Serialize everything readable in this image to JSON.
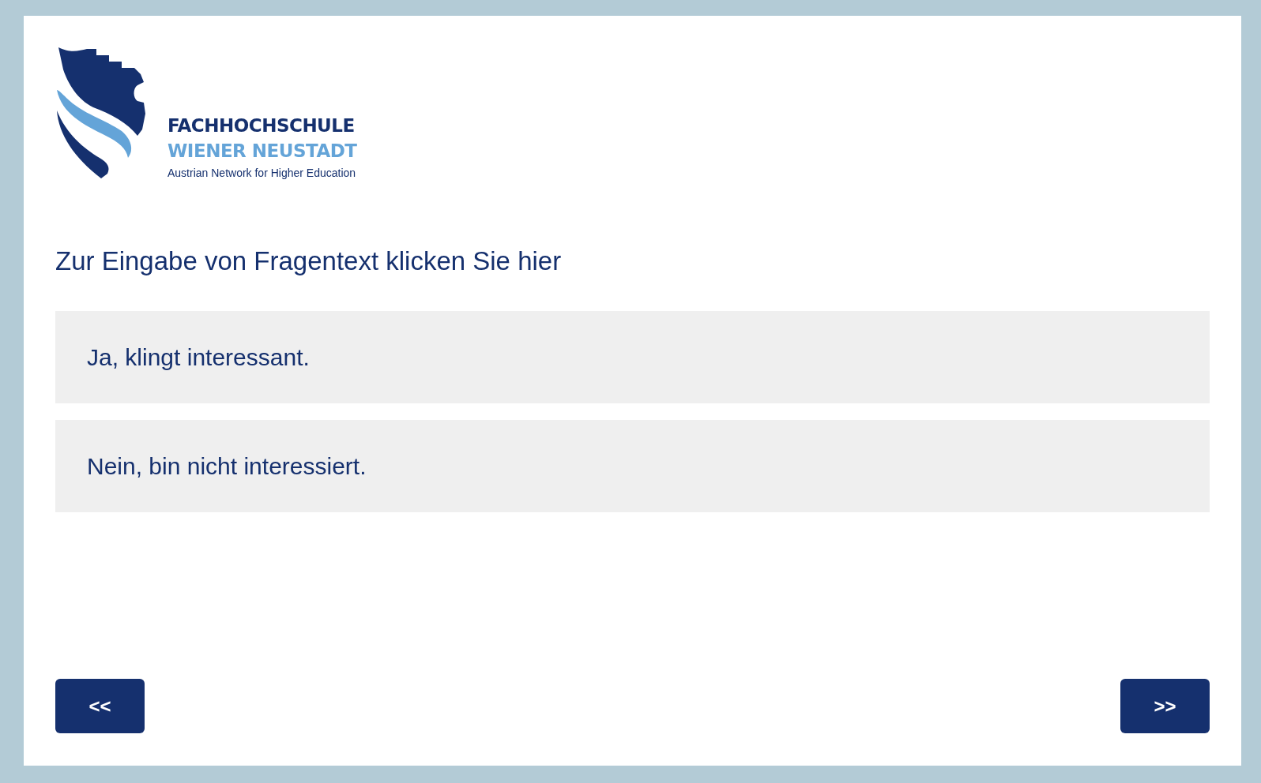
{
  "logo": {
    "line_1": "FACHHOCHSCHULE",
    "line_2": "WIENER NEUSTADT",
    "tagline": "Austrian Network for Higher Education"
  },
  "question": "Zur Eingabe von Fragentext klicken Sie hier",
  "options": [
    {
      "label": "Ja, klingt interessant.",
      "selected": false
    },
    {
      "label": "Nein, bin nicht interessiert.",
      "selected": false
    }
  ],
  "nav": {
    "back": "<<",
    "next": ">>"
  }
}
